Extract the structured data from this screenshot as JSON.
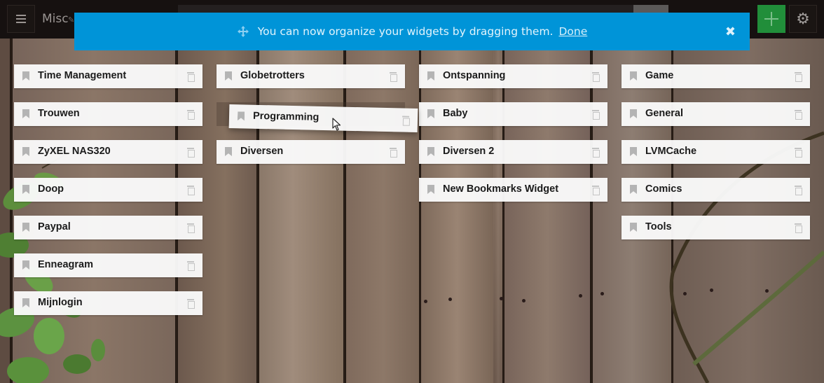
{
  "header": {
    "menu_icon": "hamburger-icon",
    "page_title": "Misc",
    "edit_icon": "pencil-icon",
    "search_value": "",
    "add_icon": "plus-icon",
    "settings_icon": "gear-icon"
  },
  "banner": {
    "icon": "move-arrows-icon",
    "message": "You can now organize your widgets by dragging them.",
    "done_label": "Done",
    "close_icon": "close-icon",
    "color": "#0094d8"
  },
  "columns": [
    {
      "widgets": [
        {
          "title": "Time Management"
        },
        {
          "title": "Trouwen"
        },
        {
          "title": "ZyXEL NAS320"
        },
        {
          "title": "Doop"
        },
        {
          "title": "Paypal"
        },
        {
          "title": "Enneagram"
        },
        {
          "title": "Mijnlogin"
        }
      ]
    },
    {
      "widgets": [
        {
          "title": "Globetrotters"
        },
        {
          "title": "Programming",
          "state": "dragging"
        },
        {
          "title": "Diversen"
        }
      ]
    },
    {
      "widgets": [
        {
          "title": "Ontspanning"
        },
        {
          "title": "Baby"
        },
        {
          "title": "Diversen 2"
        },
        {
          "title": "New Bookmarks Widget"
        }
      ]
    },
    {
      "widgets": [
        {
          "title": "Game"
        },
        {
          "title": "General"
        },
        {
          "title": "LVMCache"
        },
        {
          "title": "Comics"
        },
        {
          "title": "Tools"
        }
      ]
    }
  ],
  "widget_icons": {
    "left": "bookmark-icon",
    "right": "trash-icon"
  },
  "accent_colors": {
    "add_button": "#218e3a",
    "banner": "#0094d8"
  }
}
